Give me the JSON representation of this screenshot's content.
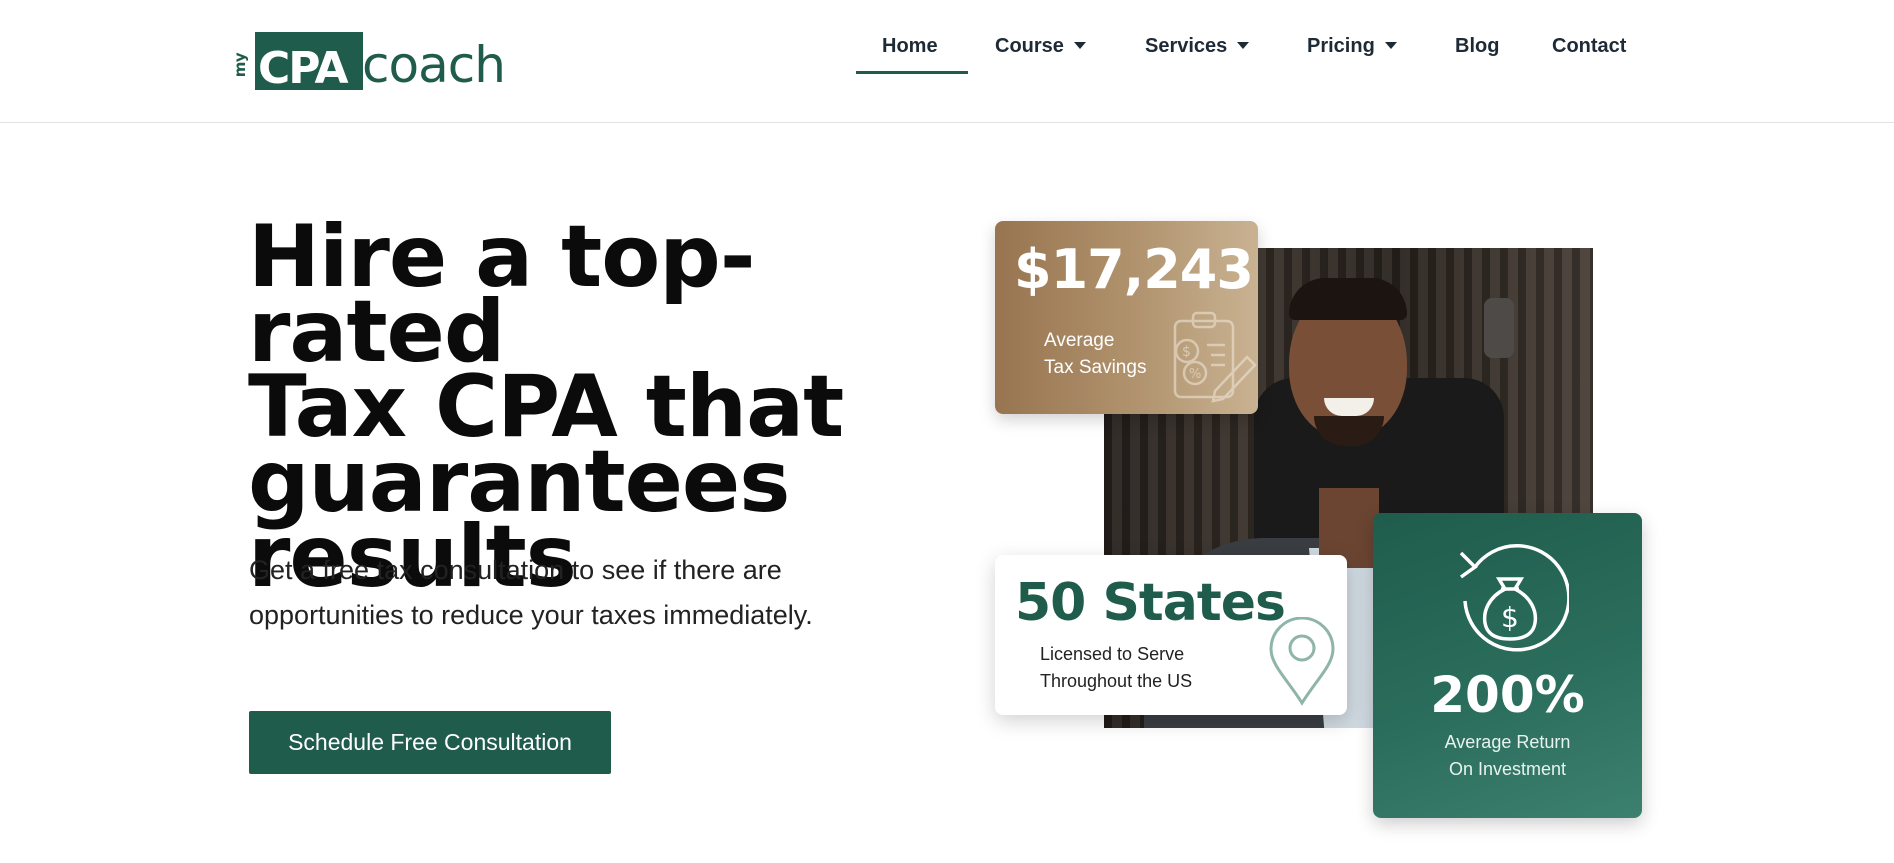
{
  "logo": {
    "my": "my",
    "cpa": "CPA",
    "coach": "coach"
  },
  "nav": {
    "items": [
      {
        "label": "Home",
        "active": true,
        "dropdown": false
      },
      {
        "label": "Course",
        "active": false,
        "dropdown": true
      },
      {
        "label": "Services",
        "active": false,
        "dropdown": true
      },
      {
        "label": "Pricing",
        "active": false,
        "dropdown": true
      },
      {
        "label": "Blog",
        "active": false,
        "dropdown": false
      },
      {
        "label": "Contact",
        "active": false,
        "dropdown": false
      }
    ]
  },
  "hero": {
    "title_lines": [
      "Hire a top-rated",
      "Tax CPA that",
      "guarantees",
      "results"
    ],
    "subtitle_lines": [
      "Get a free tax consultation to see if there are",
      "opportunities to reduce your taxes immediately."
    ],
    "cta_label": "Schedule Free Consultation"
  },
  "stats": {
    "savings": {
      "value": "$17,243",
      "label_lines": [
        "Average",
        "Tax Savings"
      ]
    },
    "states": {
      "value": "50 States",
      "label_lines": [
        "Licensed to Serve",
        "Throughout the US"
      ]
    },
    "roi": {
      "value": "200%",
      "label_lines": [
        "Average Return",
        "On Investment"
      ]
    }
  },
  "colors": {
    "brand_green": "#1f5c4c",
    "gold": "#a88760",
    "text": "#0b0b0b"
  },
  "icons": [
    "clipboard-dollar-icon",
    "map-pin-icon",
    "money-bag-cycle-icon",
    "caret-down-icon"
  ]
}
